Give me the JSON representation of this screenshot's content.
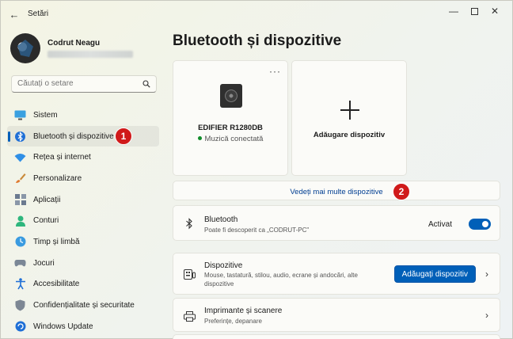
{
  "app": {
    "title": "Setări"
  },
  "profile": {
    "name": "Codrut Neagu"
  },
  "search": {
    "placeholder": "Căutați o setare"
  },
  "nav": [
    {
      "label": "Sistem",
      "icon": "monitor-icon"
    },
    {
      "label": "Bluetooth și dispozitive",
      "icon": "bluetooth-icon",
      "active": true
    },
    {
      "label": "Rețea și internet",
      "icon": "wifi-icon"
    },
    {
      "label": "Personalizare",
      "icon": "brush-icon"
    },
    {
      "label": "Aplicații",
      "icon": "apps-icon"
    },
    {
      "label": "Conturi",
      "icon": "person-icon"
    },
    {
      "label": "Timp și limbă",
      "icon": "globe-clock-icon"
    },
    {
      "label": "Jocuri",
      "icon": "gamepad-icon"
    },
    {
      "label": "Accesibilitate",
      "icon": "accessibility-icon"
    },
    {
      "label": "Confidențialitate și securitate",
      "icon": "shield-icon"
    },
    {
      "label": "Windows Update",
      "icon": "update-icon"
    }
  ],
  "badges": {
    "one": "1",
    "two": "2"
  },
  "main": {
    "title": "Bluetooth și dispozitive",
    "device_card": {
      "name": "EDIFIER R1280DB",
      "status": "Muzică conectată",
      "more": "···"
    },
    "add_card": {
      "label": "Adăugare dispozitiv"
    },
    "more_devices": "Vedeți mai multe dispozitive",
    "bluetooth": {
      "title": "Bluetooth",
      "subtitle": "Poate fi descoperit ca „CODRUT-PC\"",
      "state": "Activat",
      "on": true
    },
    "devices": {
      "title": "Dispozitive",
      "subtitle_1": "Mouse, tastatură, stilou, audio, ecrane și andocări, alte",
      "subtitle_2": "dispozitive",
      "button": "Adăugați dispozitiv"
    },
    "printers": {
      "title": "Imprimante și scanere",
      "subtitle": "Preferințe, depanare"
    }
  },
  "colors": {
    "accent": "#005fb8",
    "badge": "#d01a1a",
    "status_green": "#108c2a"
  }
}
